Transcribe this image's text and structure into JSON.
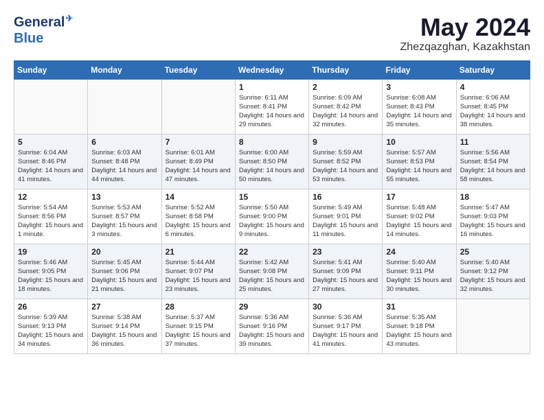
{
  "header": {
    "logo_line1": "General",
    "logo_line2": "Blue",
    "month_year": "May 2024",
    "location": "Zhezqazghan, Kazakhstan"
  },
  "weekdays": [
    "Sunday",
    "Monday",
    "Tuesday",
    "Wednesday",
    "Thursday",
    "Friday",
    "Saturday"
  ],
  "rows": [
    [
      {
        "day": "",
        "info": ""
      },
      {
        "day": "",
        "info": ""
      },
      {
        "day": "",
        "info": ""
      },
      {
        "day": "1",
        "info": "Sunrise: 6:11 AM\nSunset: 8:41 PM\nDaylight: 14 hours and 29 minutes."
      },
      {
        "day": "2",
        "info": "Sunrise: 6:09 AM\nSunset: 8:42 PM\nDaylight: 14 hours and 32 minutes."
      },
      {
        "day": "3",
        "info": "Sunrise: 6:08 AM\nSunset: 8:43 PM\nDaylight: 14 hours and 35 minutes."
      },
      {
        "day": "4",
        "info": "Sunrise: 6:06 AM\nSunset: 8:45 PM\nDaylight: 14 hours and 38 minutes."
      }
    ],
    [
      {
        "day": "5",
        "info": "Sunrise: 6:04 AM\nSunset: 8:46 PM\nDaylight: 14 hours and 41 minutes."
      },
      {
        "day": "6",
        "info": "Sunrise: 6:03 AM\nSunset: 8:48 PM\nDaylight: 14 hours and 44 minutes."
      },
      {
        "day": "7",
        "info": "Sunrise: 6:01 AM\nSunset: 8:49 PM\nDaylight: 14 hours and 47 minutes."
      },
      {
        "day": "8",
        "info": "Sunrise: 6:00 AM\nSunset: 8:50 PM\nDaylight: 14 hours and 50 minutes."
      },
      {
        "day": "9",
        "info": "Sunrise: 5:59 AM\nSunset: 8:52 PM\nDaylight: 14 hours and 53 minutes."
      },
      {
        "day": "10",
        "info": "Sunrise: 5:57 AM\nSunset: 8:53 PM\nDaylight: 14 hours and 55 minutes."
      },
      {
        "day": "11",
        "info": "Sunrise: 5:56 AM\nSunset: 8:54 PM\nDaylight: 14 hours and 58 minutes."
      }
    ],
    [
      {
        "day": "12",
        "info": "Sunrise: 5:54 AM\nSunset: 8:56 PM\nDaylight: 15 hours and 1 minute."
      },
      {
        "day": "13",
        "info": "Sunrise: 5:53 AM\nSunset: 8:57 PM\nDaylight: 15 hours and 3 minutes."
      },
      {
        "day": "14",
        "info": "Sunrise: 5:52 AM\nSunset: 8:58 PM\nDaylight: 15 hours and 6 minutes."
      },
      {
        "day": "15",
        "info": "Sunrise: 5:50 AM\nSunset: 9:00 PM\nDaylight: 15 hours and 9 minutes."
      },
      {
        "day": "16",
        "info": "Sunrise: 5:49 AM\nSunset: 9:01 PM\nDaylight: 15 hours and 11 minutes."
      },
      {
        "day": "17",
        "info": "Sunrise: 5:48 AM\nSunset: 9:02 PM\nDaylight: 15 hours and 14 minutes."
      },
      {
        "day": "18",
        "info": "Sunrise: 5:47 AM\nSunset: 9:03 PM\nDaylight: 15 hours and 16 minutes."
      }
    ],
    [
      {
        "day": "19",
        "info": "Sunrise: 5:46 AM\nSunset: 9:05 PM\nDaylight: 15 hours and 18 minutes."
      },
      {
        "day": "20",
        "info": "Sunrise: 5:45 AM\nSunset: 9:06 PM\nDaylight: 15 hours and 21 minutes."
      },
      {
        "day": "21",
        "info": "Sunrise: 5:44 AM\nSunset: 9:07 PM\nDaylight: 15 hours and 23 minutes."
      },
      {
        "day": "22",
        "info": "Sunrise: 5:42 AM\nSunset: 9:08 PM\nDaylight: 15 hours and 25 minutes."
      },
      {
        "day": "23",
        "info": "Sunrise: 5:41 AM\nSunset: 9:09 PM\nDaylight: 15 hours and 27 minutes."
      },
      {
        "day": "24",
        "info": "Sunrise: 5:40 AM\nSunset: 9:11 PM\nDaylight: 15 hours and 30 minutes."
      },
      {
        "day": "25",
        "info": "Sunrise: 5:40 AM\nSunset: 9:12 PM\nDaylight: 15 hours and 32 minutes."
      }
    ],
    [
      {
        "day": "26",
        "info": "Sunrise: 5:39 AM\nSunset: 9:13 PM\nDaylight: 15 hours and 34 minutes."
      },
      {
        "day": "27",
        "info": "Sunrise: 5:38 AM\nSunset: 9:14 PM\nDaylight: 15 hours and 36 minutes."
      },
      {
        "day": "28",
        "info": "Sunrise: 5:37 AM\nSunset: 9:15 PM\nDaylight: 15 hours and 37 minutes."
      },
      {
        "day": "29",
        "info": "Sunrise: 5:36 AM\nSunset: 9:16 PM\nDaylight: 15 hours and 39 minutes."
      },
      {
        "day": "30",
        "info": "Sunrise: 5:36 AM\nSunset: 9:17 PM\nDaylight: 15 hours and 41 minutes."
      },
      {
        "day": "31",
        "info": "Sunrise: 5:35 AM\nSunset: 9:18 PM\nDaylight: 15 hours and 43 minutes."
      },
      {
        "day": "",
        "info": ""
      }
    ]
  ]
}
